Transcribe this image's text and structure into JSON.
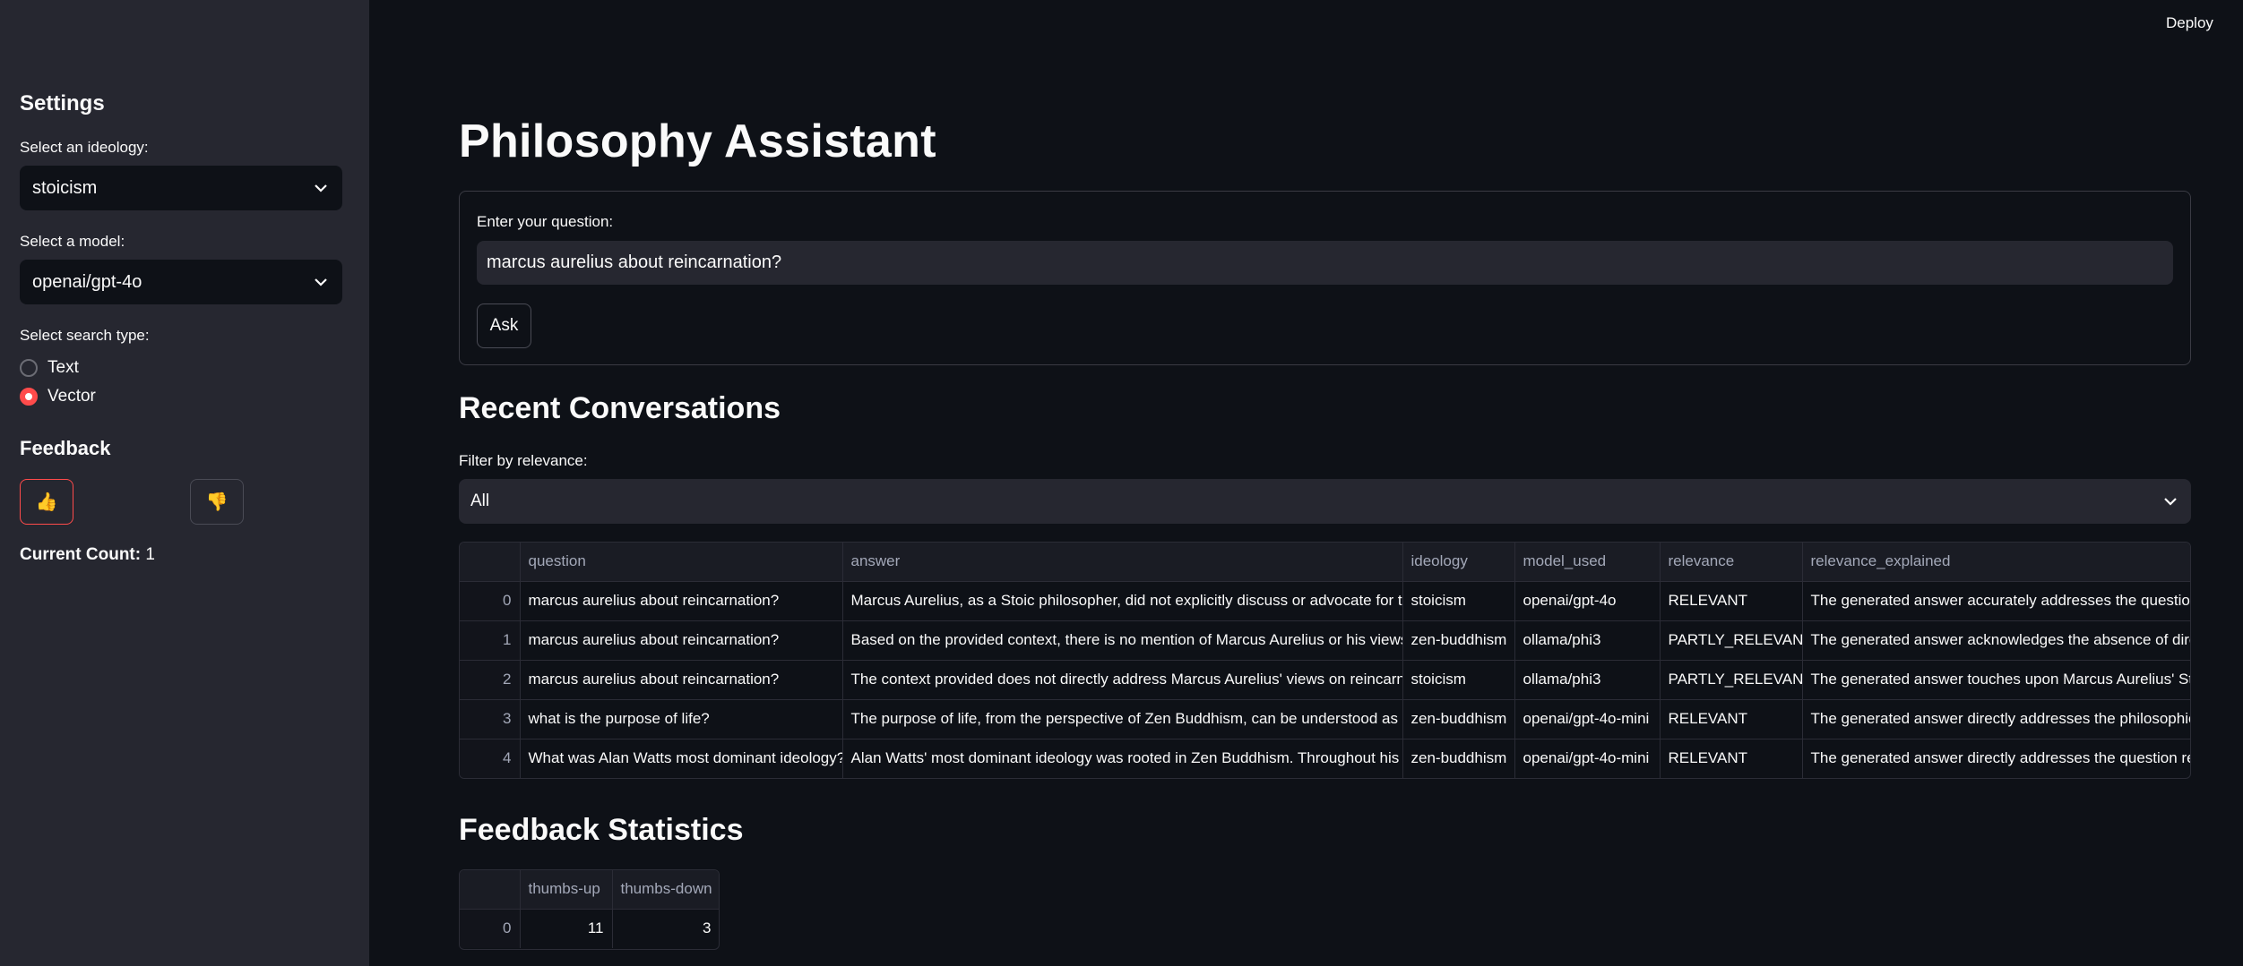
{
  "topbar": {
    "deploy_label": "Deploy",
    "menu_glyph": "⋮"
  },
  "sidebar": {
    "heading": "Settings",
    "ideology": {
      "label": "Select an ideology:",
      "value": "stoicism"
    },
    "model": {
      "label": "Select a model:",
      "value": "openai/gpt-4o"
    },
    "search_type": {
      "label": "Select search type:",
      "options": [
        {
          "label": "Text",
          "selected": false
        },
        {
          "label": "Vector",
          "selected": true
        }
      ]
    },
    "feedback": {
      "heading": "Feedback",
      "thumbs_up": "👍",
      "thumbs_down": "👎",
      "count_label": "Current Count:",
      "count_value": "1"
    }
  },
  "main": {
    "title": "Philosophy Assistant",
    "question_label": "Enter your question:",
    "question_value": "marcus aurelius about reincarnation?",
    "ask_label": "Ask",
    "recent_heading": "Recent Conversations",
    "filter_label": "Filter by relevance:",
    "filter_value": "All",
    "conversations": {
      "columns": [
        "",
        "question",
        "answer",
        "ideology",
        "model_used",
        "relevance",
        "relevance_explained"
      ],
      "rows": [
        [
          "0",
          "marcus aurelius about reincarnation?",
          "Marcus Aurelius, as a Stoic philosopher, did not explicitly discuss or advocate for the c",
          "stoicism",
          "openai/gpt-4o",
          "RELEVANT",
          "The generated answer accurately addresses the question a"
        ],
        [
          "1",
          "marcus aurelius about reincarnation?",
          "Based on the provided context, there is no mention of Marcus Aurelius or his views on",
          "zen-buddhism",
          "ollama/phi3",
          "PARTLY_RELEVANT",
          "The generated answer acknowledges the absence of direct"
        ],
        [
          "2",
          "marcus aurelius about reincarnation?",
          "The context provided does not directly address Marcus Aurelius' views on reincarnati",
          "stoicism",
          "ollama/phi3",
          "PARTLY_RELEVANT",
          "The generated answer touches upon Marcus Aurelius' Stoic"
        ],
        [
          "3",
          "what is the purpose of life?",
          "The purpose of life, from the perspective of Zen Buddhism, can be understood as awa",
          "zen-buddhism",
          "openai/gpt-4o-mini",
          "RELEVANT",
          "The generated answer directly addresses the philosophical"
        ],
        [
          "4",
          "What was Alan Watts most dominant ideology?",
          "Alan Watts' most dominant ideology was rooted in Zen Buddhism. Throughout his wo",
          "zen-buddhism",
          "openai/gpt-4o-mini",
          "RELEVANT",
          "The generated answer directly addresses the question rega"
        ]
      ]
    },
    "stats_heading": "Feedback Statistics",
    "stats": {
      "columns": [
        "",
        "thumbs-up",
        "thumbs-down"
      ],
      "rows": [
        [
          "0",
          "11",
          "3"
        ]
      ]
    }
  }
}
